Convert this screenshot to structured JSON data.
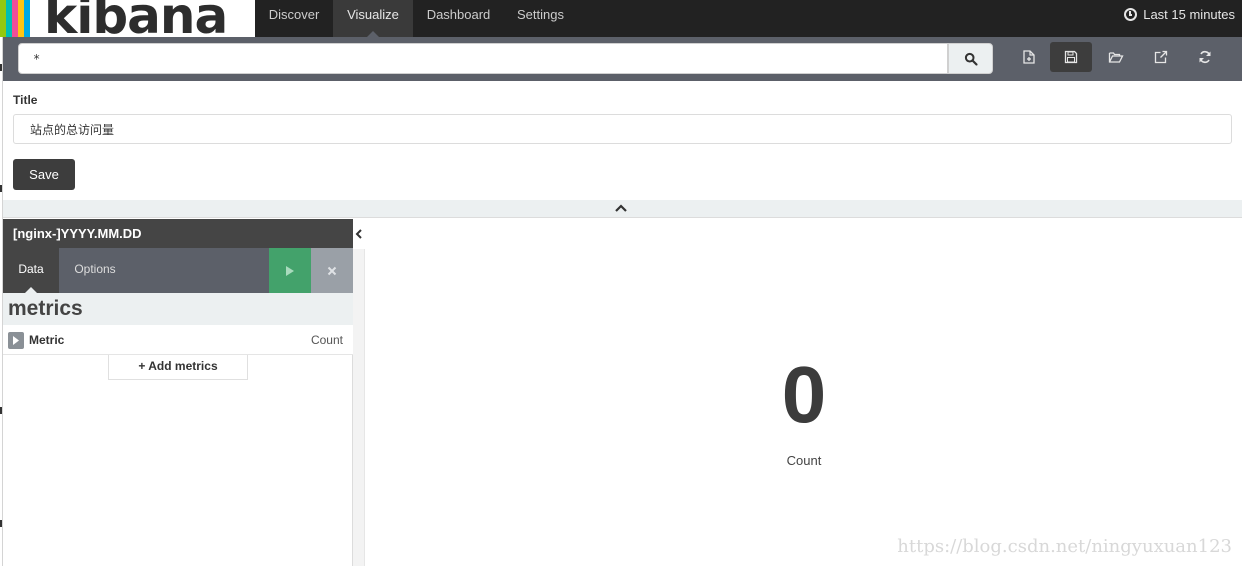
{
  "app": {
    "logo_text": "kibana"
  },
  "nav": {
    "tabs": [
      {
        "label": "Discover"
      },
      {
        "label": "Visualize",
        "active": true
      },
      {
        "label": "Dashboard"
      },
      {
        "label": "Settings"
      }
    ],
    "time_range": "Last 15 minutes"
  },
  "search": {
    "value": "*"
  },
  "toolbar": {
    "icons": [
      "new-visualization-icon",
      "save-icon",
      "open-icon",
      "share-icon",
      "refresh-icon"
    ]
  },
  "save_panel": {
    "title_label": "Title",
    "title_value": "站点的总访问量",
    "save_label": "Save"
  },
  "sidebar": {
    "index_pattern": "[nginx-]YYYY.MM.DD",
    "tabs": [
      {
        "label": "Data",
        "active": true
      },
      {
        "label": "Options"
      }
    ],
    "metrics_heading": "metrics",
    "metric": {
      "label": "Metric",
      "aggregation": "Count"
    },
    "add_metrics_label": "Add metrics"
  },
  "visualization": {
    "value": "0",
    "label": "Count"
  },
  "watermark": "https://blog.csdn.net/ningyuxuan123",
  "colors": {
    "nav_bg": "#222222",
    "search_bar_bg": "#5c6069",
    "apply_green": "#43a26b",
    "panel_gray": "#ecf0f1",
    "logo_stripes": [
      "#00a9e5",
      "#f04e98",
      "#fec514",
      "#00bfb3",
      "#93c90e"
    ]
  }
}
